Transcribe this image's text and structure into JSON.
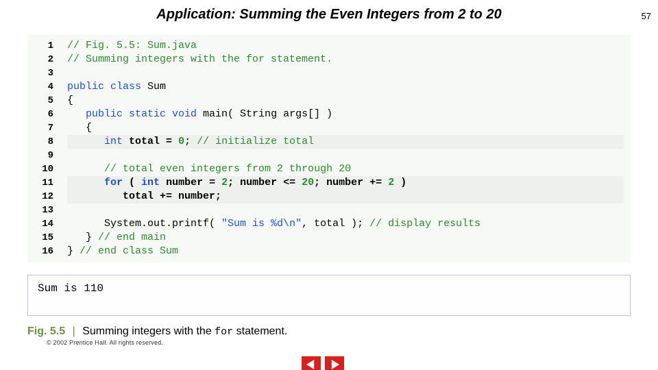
{
  "pageNumber": "57",
  "title": "Application: Summing the Even Integers from 2 to 20",
  "code": {
    "lines": [
      {
        "n": "1",
        "tokens": [
          {
            "t": "// Fig. 5.5: Sum.java",
            "cls": "cmt"
          }
        ]
      },
      {
        "n": "2",
        "tokens": [
          {
            "t": "// Summing integers with the for statement.",
            "cls": "cmt"
          }
        ]
      },
      {
        "n": "3",
        "tokens": [
          {
            "t": "",
            "cls": ""
          }
        ]
      },
      {
        "n": "4",
        "tokens": [
          {
            "t": "public class ",
            "cls": "kw"
          },
          {
            "t": "Sum",
            "cls": ""
          }
        ]
      },
      {
        "n": "5",
        "tokens": [
          {
            "t": "{",
            "cls": ""
          }
        ]
      },
      {
        "n": "6",
        "tokens": [
          {
            "t": "   ",
            "cls": ""
          },
          {
            "t": "public static void ",
            "cls": "kw"
          },
          {
            "t": "main( String args[] )",
            "cls": ""
          }
        ]
      },
      {
        "n": "7",
        "tokens": [
          {
            "t": "   {",
            "cls": ""
          }
        ]
      },
      {
        "n": "8",
        "hl": true,
        "tokens": [
          {
            "t": "      ",
            "cls": ""
          },
          {
            "t": "int",
            "cls": "kw"
          },
          {
            "t": " ",
            "cls": ""
          },
          {
            "t": "total = ",
            "cls": "bold"
          },
          {
            "t": "0",
            "cls": "num bold"
          },
          {
            "t": "; ",
            "cls": ""
          },
          {
            "t": "// initialize total",
            "cls": "cmt"
          }
        ]
      },
      {
        "n": "9",
        "tokens": [
          {
            "t": "",
            "cls": ""
          }
        ]
      },
      {
        "n": "10",
        "tokens": [
          {
            "t": "      ",
            "cls": ""
          },
          {
            "t": "// total even integers from 2 through 20",
            "cls": "cmt"
          }
        ]
      },
      {
        "n": "11",
        "hl": true,
        "tokens": [
          {
            "t": "      ",
            "cls": ""
          },
          {
            "t": "for ",
            "cls": "kw bold"
          },
          {
            "t": "( ",
            "cls": "bold"
          },
          {
            "t": "int",
            "cls": "kw bold"
          },
          {
            "t": " ",
            "cls": "bold"
          },
          {
            "t": "number = ",
            "cls": "bold"
          },
          {
            "t": "2",
            "cls": "num bold"
          },
          {
            "t": "; number <= ",
            "cls": "bold"
          },
          {
            "t": "20",
            "cls": "num bold"
          },
          {
            "t": "; number += ",
            "cls": "bold"
          },
          {
            "t": "2",
            "cls": "num bold"
          },
          {
            "t": " )",
            "cls": "bold"
          }
        ]
      },
      {
        "n": "12",
        "hl": true,
        "tokens": [
          {
            "t": "         total += number;",
            "cls": "bold"
          }
        ]
      },
      {
        "n": "13",
        "tokens": [
          {
            "t": "",
            "cls": ""
          }
        ]
      },
      {
        "n": "14",
        "tokens": [
          {
            "t": "      System.out.printf( ",
            "cls": ""
          },
          {
            "t": "\"Sum is %d\\n\"",
            "cls": "str"
          },
          {
            "t": ", total ); ",
            "cls": ""
          },
          {
            "t": "// display results",
            "cls": "cmt"
          }
        ]
      },
      {
        "n": "15",
        "tokens": [
          {
            "t": "   } ",
            "cls": ""
          },
          {
            "t": "// end main",
            "cls": "cmt"
          }
        ]
      },
      {
        "n": "16",
        "tokens": [
          {
            "t": "} ",
            "cls": ""
          },
          {
            "t": "// end class Sum",
            "cls": "cmt"
          }
        ]
      }
    ]
  },
  "output": "Sum is 110",
  "figure": {
    "num": "Fig. 5.5",
    "sep": "|",
    "pre": "Summing integers with the ",
    "mono": "for",
    "post": " statement."
  },
  "copyright": "© 2002 Prentice Hall.  All rights reserved."
}
